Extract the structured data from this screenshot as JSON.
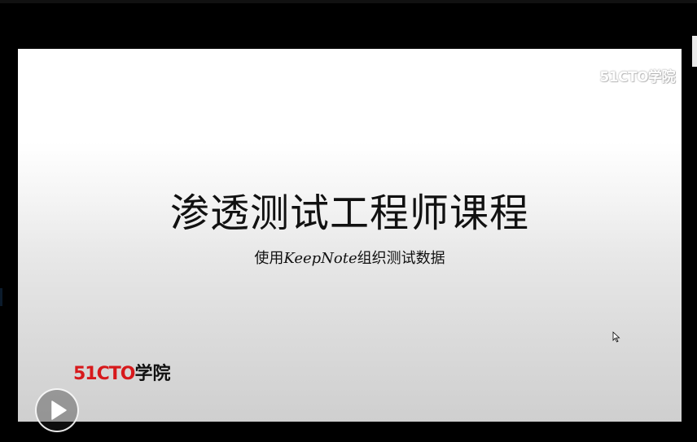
{
  "slide": {
    "watermark_num": "51CTO",
    "watermark_cn": "学院",
    "title": "渗透测试工程师课程",
    "subtitle_prefix": "使用",
    "subtitle_app": "KeepNote",
    "subtitle_suffix": "组织测试数据",
    "brand_num": "51CTO",
    "brand_cn": "学院"
  },
  "player": {
    "play_icon": "play-icon"
  },
  "colors": {
    "brand_red": "#d7191c",
    "title_text": "#111111",
    "frame": "#000000"
  }
}
